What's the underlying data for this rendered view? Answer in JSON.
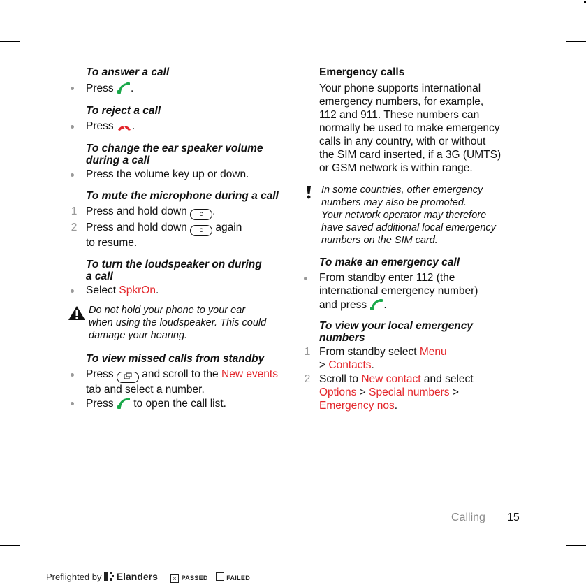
{
  "left_column": {
    "answer": {
      "heading": "To answer a call",
      "press": "Press",
      "end": "."
    },
    "reject": {
      "heading": "To reject a call",
      "press": "Press",
      "end": "."
    },
    "volume": {
      "heading_line1": "To change the ear speaker volume",
      "heading_line2": "during a call",
      "text": "Press the volume key up or down."
    },
    "mute": {
      "heading": "To mute the microphone during a call",
      "steps": [
        {
          "num": "1",
          "text": "Press and hold down",
          "key": "c",
          "end": "."
        },
        {
          "num": "2",
          "text": "Press and hold down",
          "key": "c",
          "after": "again",
          "line2": "to resume."
        }
      ]
    },
    "loudspeaker": {
      "heading_line1": "To turn the loudspeaker on during",
      "heading_line2": "a call",
      "select": "Select",
      "option": "SpkrOn",
      "end": "."
    },
    "warning": {
      "line1": "Do not hold your phone to your ear",
      "line2": "when using the loudspeaker. This could",
      "line3": "damage your hearing."
    },
    "missed": {
      "heading": "To view missed calls from standby",
      "b1_press": "Press",
      "b1_mid": "and scroll to the",
      "b1_tab": "New events",
      "b1_line2": "tab and select a number.",
      "b2_press": "Press",
      "b2_rest": "to open the call list."
    }
  },
  "right_column": {
    "title": "Emergency calls",
    "paragraph": [
      "Your phone supports international",
      "emergency numbers, for example,",
      "112 and 911. These numbers can",
      "normally be used to make emergency",
      "calls in any country, with or without",
      "the SIM card inserted, if a 3G (UMTS)",
      "or GSM network is within range."
    ],
    "note": [
      "In some countries, other emergency",
      "numbers may also be promoted.",
      "Your network operator may therefore",
      "have saved additional local emergency",
      "numbers on the SIM card."
    ],
    "make_call": {
      "heading": "To make an emergency call",
      "line1": "From standby enter 112 (the",
      "line2": "international emergency number)",
      "line3": "and press",
      "end": "."
    },
    "local": {
      "heading_line1": "To view your local emergency",
      "heading_line2": "numbers",
      "step1": {
        "num": "1",
        "text": "From standby select",
        "menu": "Menu",
        "sep": ">",
        "contacts": "Contacts",
        "end": "."
      },
      "step2": {
        "num": "2",
        "text": "Scroll to",
        "new_contact": "New contact",
        "mid": "and select",
        "options": "Options",
        "sep1": ">",
        "special": "Special numbers",
        "sep2": ">",
        "emergency": "Emergency nos",
        "end": "."
      }
    }
  },
  "footer": {
    "section": "Calling",
    "page": "15"
  },
  "preflight": {
    "label": "Preflighted by",
    "brand": "Elanders",
    "passed": "PASSED",
    "failed": "FAILED",
    "passed_mark": "×"
  },
  "colors": {
    "accent_red": "#e3262b",
    "call_green": "#1aa84a",
    "muted_gray": "#999999"
  }
}
